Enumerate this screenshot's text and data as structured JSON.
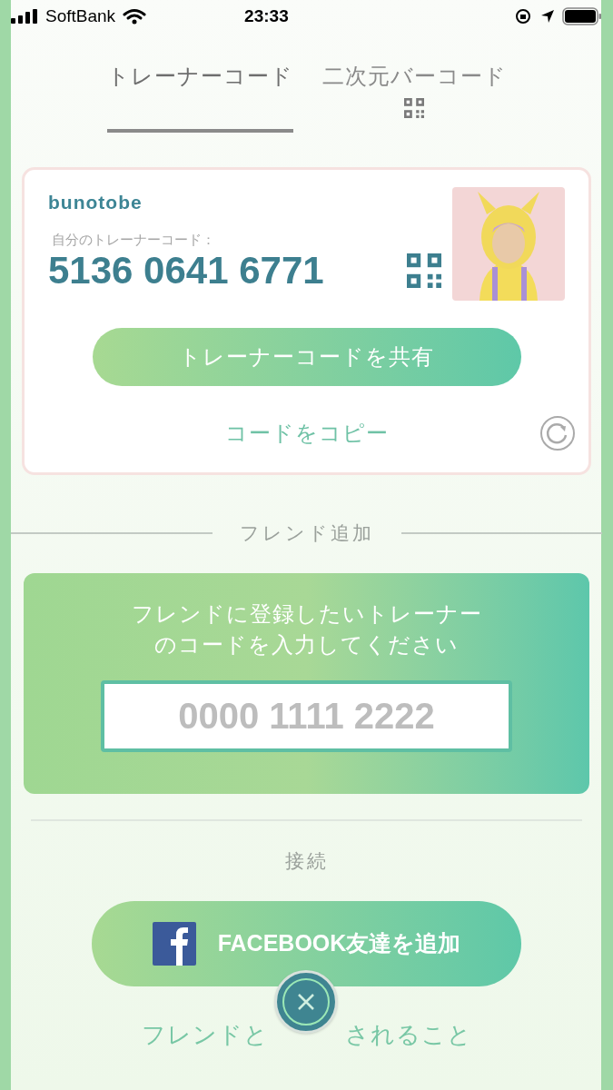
{
  "status_bar": {
    "carrier": "SoftBank",
    "time": "23:33"
  },
  "tabs": [
    {
      "label": "トレーナーコード",
      "selected": true,
      "kind": "text"
    },
    {
      "label": "二次元バーコード",
      "selected": false,
      "kind": "qr"
    }
  ],
  "trainer_card": {
    "username": "bunotobe",
    "code_label": "自分のトレーナーコード：",
    "code": "5136 0641 6771",
    "share_button": "トレーナーコードを共有",
    "copy_link": "コードをコピー"
  },
  "friend_add": {
    "title": "フレンド追加",
    "instructions": "フレンドに登録したいトレーナーのコードを入力してください",
    "input": {
      "placeholder": "0000 1111 2222"
    }
  },
  "connect": {
    "title": "接続",
    "facebook_button": "FACEBOOK友達を追加",
    "link_parts": [
      "フレンドと",
      "されること"
    ]
  }
}
